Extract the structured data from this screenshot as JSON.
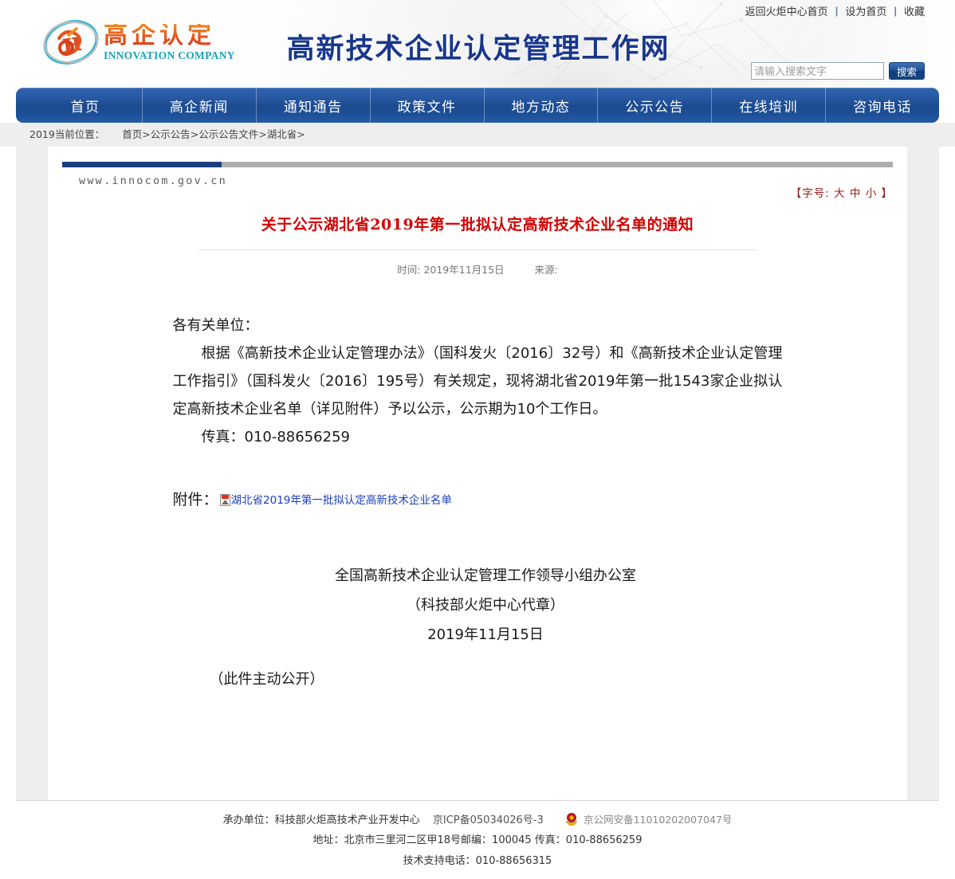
{
  "header": {
    "logo_cn": "高企认定",
    "logo_en": "INNOVATION COMPANY",
    "site_title": "高新技术企业认定管理工作网",
    "top_links": [
      {
        "label": "返回火炬中心首页"
      },
      {
        "label": "设为首页"
      },
      {
        "label": "收藏"
      }
    ],
    "separator": "|",
    "search": {
      "placeholder": "请输入搜索文字",
      "value": "",
      "button_label": "搜索"
    }
  },
  "nav": {
    "items": [
      {
        "label": "首页"
      },
      {
        "label": "高企新闻"
      },
      {
        "label": "通知通告"
      },
      {
        "label": "政策文件"
      },
      {
        "label": "地方动态"
      },
      {
        "label": "公示公告"
      },
      {
        "label": "在线培训"
      },
      {
        "label": "咨询电话"
      }
    ]
  },
  "breadcrumb": {
    "prefix": "2019当前位置：",
    "path": "首页>公示公告>公示公告文件>湖北省>"
  },
  "content": {
    "site_url": "www.innocom.gov.cn",
    "fontsize": {
      "label": "【字号:",
      "large": "大",
      "medium": "中",
      "small": "小",
      "close": "】"
    },
    "article": {
      "title": "关于公示湖北省2019年第一批拟认定高新技术企业名单的通知",
      "time_label": "时间:",
      "time_value": "2019年11月15日",
      "source_label": "来源:",
      "source_value": "",
      "paragraphs": [
        "各有关单位：",
        "根据《高新技术企业认定管理办法》（国科发火〔2016〕32号）和《高新技术企业认定管理工作指引》（国科发火〔2016〕195号）有关规定，现将湖北省2019年第一批1543家企业拟认定高新技术企业名单（详见附件）予以公示，公示期为10个工作日。",
        "传真：010-88656259"
      ],
      "attachment_label": "附件：",
      "attachment_name": "湖北省2019年第一批拟认定高新技术企业名单",
      "sign_office": "全国高新技术企业认定管理工作领导小组办公室",
      "sign_seal": "（科技部火炬中心代章）",
      "sign_date": "2019年11月15日",
      "disclose_note": "（此件主动公开）"
    }
  },
  "footer": {
    "line1_prefix": "承办单位：科技部火炬高技术产业开发中心",
    "icp": "京ICP备05034026号-3",
    "police_record": "京公网安备11010202007047号",
    "line2": "地址：北京市三里河二区甲18号邮编：100045  传真：010-88656259",
    "line3": "技术支持电话：010-88656315"
  },
  "colors": {
    "nav_blue": "#1b4a8f",
    "title_blue": "#18378c",
    "article_red": "#d40000",
    "fontsize_red": "#9a1b1b",
    "bar_navy": "#1b3f7e",
    "link_blue": "#1a3fbf"
  }
}
